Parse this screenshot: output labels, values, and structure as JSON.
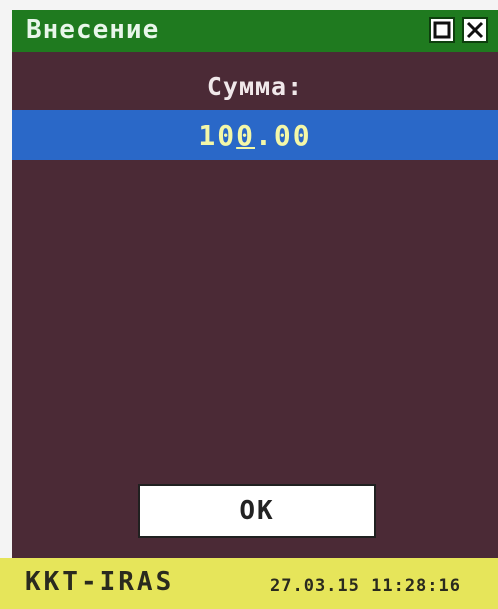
{
  "window": {
    "title": "Внесение",
    "controls": {
      "restore_icon": "restore-icon",
      "close_icon": "close-icon"
    }
  },
  "form": {
    "label": "Сумма:",
    "amount_before_cursor": "10",
    "amount_cursor_char": "0",
    "amount_after_cursor": ".00"
  },
  "actions": {
    "ok_label": "OK"
  },
  "status": {
    "device": "KKT-IRAS",
    "datetime": "27.03.15 11:28:16"
  },
  "colors": {
    "screen_bg": "#4b2a36",
    "titlebar_bg": "#1f7a1f",
    "amount_bar_bg": "#2a68c8",
    "amount_text": "#f3f7a8",
    "statusbar_bg": "#e6e55a"
  }
}
